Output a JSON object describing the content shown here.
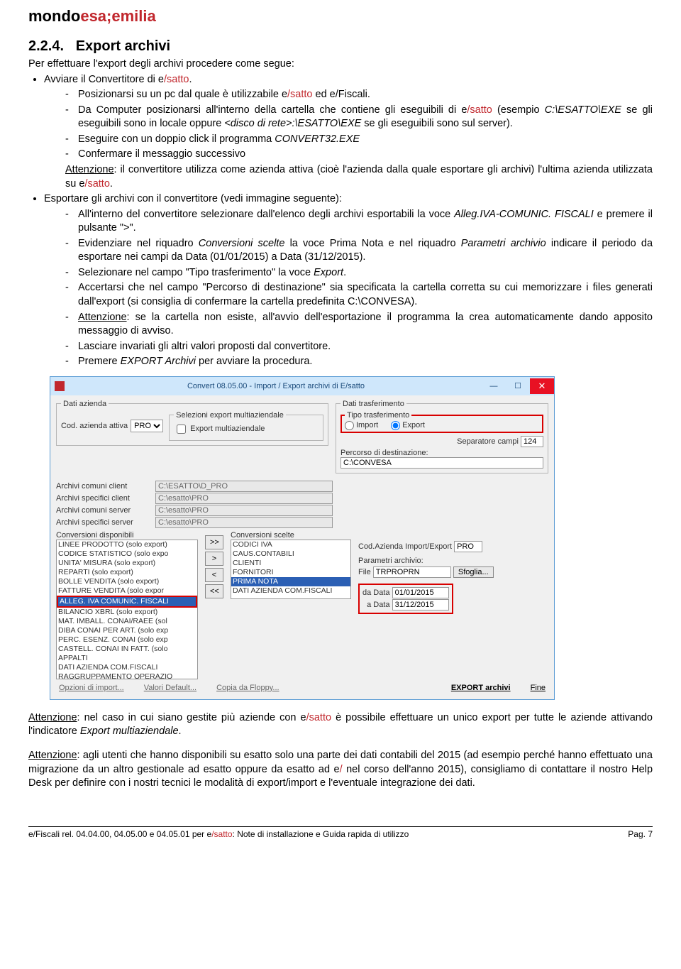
{
  "brand": {
    "part1": "mondo",
    "part2": "esa;emilia"
  },
  "section": {
    "number": "2.2.4.",
    "title": "Export archivi"
  },
  "intro": "Per effettuare l'export degli archivi procedere come segue:",
  "b1": {
    "pre": "Avviare il Convertitore di e",
    "satto": "/satto",
    "post": "."
  },
  "b1d1": {
    "pre": "Posizionarsi su un pc dal quale è utilizzabile e",
    "satto": "/satto",
    "post": " ed e/Fiscali."
  },
  "b1d2": {
    "pre": "Da Computer posizionarsi all'interno della cartella che contiene gli eseguibili di e",
    "satto1": "/satto",
    "mid1": " (esempio ",
    "ital1": "C:\\ESATTO\\EXE",
    "mid2": " se gli eseguibili sono in locale oppure ",
    "ital2": "<disco di rete>:\\ESATTO\\EXE",
    "post": " se gli eseguibili sono sul server)."
  },
  "b1d3": {
    "pre": "Eseguire con un doppio click il programma ",
    "ital": "CONVERT32.EXE"
  },
  "b1d4": "Confermare il messaggio successivo",
  "att1": {
    "u": "Attenzione",
    "pre": ": il convertitore utilizza come azienda attiva (cioè l'azienda dalla quale esportare gli archivi) l'ultima azienda utilizzata su e",
    "satto": "/satto",
    "post": "."
  },
  "b2": "Esportare gli archivi con il convertitore (vedi immagine seguente):",
  "b2d1": {
    "pre": "All'interno del convertitore selezionare dall'elenco degli archivi esportabili la voce ",
    "ital": "Alleg.IVA-COMUNIC. FISCALI",
    "post": " e premere il pulsante \">\"."
  },
  "b2d2": {
    "pre": "Evidenziare nel riquadro ",
    "i1": "Conversioni scelte",
    "mid1": " la voce Prima Nota e nel riquadro ",
    "i2": "Parametri archivio",
    "post": " indicare il periodo da esportare nei campi da Data (01/01/2015) a Data (31/12/2015)."
  },
  "b2d3": {
    "pre": "Selezionare nel campo \"Tipo trasferimento\" la voce ",
    "ital": "Export",
    "post": "."
  },
  "b2d4": "Accertarsi che nel campo \"Percorso di destinazione\" sia specificata la cartella corretta su cui memorizzare i files generati dall'export (si consiglia di confermare la cartella predefinita C:\\CONVESA).",
  "b2d5": {
    "u": "Attenzione",
    "post": ": se la cartella non esiste, all'avvio dell'esportazione il programma la crea automaticamente dando apposito messaggio di avviso."
  },
  "b2d6": "Lasciare invariati gli altri valori proposti dal convertitore.",
  "b2d7": {
    "pre": "Premere ",
    "ital": "EXPORT Archivi",
    "post": " per avviare la procedura."
  },
  "win": {
    "title": "Convert 08.05.00 - Import / Export archivi di E/satto",
    "fs_dati": "Dati azienda",
    "cod_az_label": "Cod. azienda attiva",
    "cod_az_val": "PRO",
    "fs_sel": "Selezioni export multiaziendale",
    "chk_multi": "Export multiaziendale",
    "fs_trasf": "Dati trasferimento",
    "fs_tipo": "Tipo trasferimento",
    "r_import": "Import",
    "r_export": "Export",
    "sep_label": "Separatore campi",
    "sep_val": "124",
    "perc_label": "Percorso di destinazione:",
    "perc_val": "C:\\CONVESA",
    "acc_label": "Archivi comuni client",
    "acc_val": "C:\\ESATTO\\D_PRO",
    "asc_label": "Archivi specifici client",
    "asc_val": "C:\\esatto\\PRO",
    "acs_label": "Archivi comuni server",
    "acs_val": "C:\\esatto\\PRO",
    "ass_label": "Archivi specifici server",
    "ass_val": "C:\\esatto\\PRO",
    "fs_disp": "Conversioni disponibili",
    "disp": [
      "LINEE PRODOTTO (solo export)",
      "CODICE STATISTICO (solo expo",
      "UNITA' MISURA (solo export)",
      "REPARTI (solo export)",
      "BOLLE VENDITA (solo export)",
      "FATTURE VENDITA (solo expor",
      "ALLEG. IVA COMUNIC. FISCALI",
      "BILANCIO XBRL (solo export)",
      "MAT. IMBALL. CONAI/RAEE (sol",
      "DIBA CONAI PER ART. (solo exp",
      "PERC. ESENZ. CONAI (solo exp",
      "CASTELL. CONAI IN FATT. (solo",
      "APPALTI",
      "DATI AZIENDA COM.FISCALI",
      "RAGGRUPPAMENTO OPERAZIO"
    ],
    "fs_scelte": "Conversioni scelte",
    "scelte": [
      "CODICI IVA",
      "CAUS.CONTABILI",
      "CLIENTI",
      "FORNITORI",
      "PRIMA NOTA",
      "DATI AZIENDA COM.FISCALI"
    ],
    "cod_ie_label": "Cod.Azienda Import/Export",
    "cod_ie_val": "PRO",
    "par_label": "Parametri archivio:",
    "file_label": "File",
    "file_val": "TRPROPRN",
    "sfoglia": "Sfoglia...",
    "da_label": "da Data",
    "da_val": "01/01/2015",
    "a_label": "a Data",
    "a_val": "31/12/2015",
    "btn_opz": "Opzioni di import...",
    "btn_val": "Valori Default...",
    "btn_floppy": "Copia da Floppy...",
    "btn_export": "EXPORT archivi",
    "btn_fine": "Fine"
  },
  "att2": {
    "u": "Attenzione",
    "pre": ": nel caso in cui siano gestite più aziende con e",
    "satto": "/satto",
    "mid": " è possibile effettuare un unico export per tutte le aziende attivando l'indicatore ",
    "ital": "Export multiaziendale",
    "post": "."
  },
  "att3": {
    "u": "Attenzione",
    "pre": ": agli utenti che hanno disponibili su esatto solo una parte dei dati contabili del 2015 (ad esempio perché hanno effettuato una migrazione da un altro gestionale ad esatto oppure da esatto ad e",
    "red": "/",
    "post": " nel corso dell'anno 2015), consigliamo di contattare il nostro Help Desk per definire con i nostri tecnici le modalità di export/import e l'eventuale integrazione dei dati."
  },
  "footer": {
    "left_pre": "e/Fiscali rel. 04.04.00, 04.05.00 e 04.05.01 per e",
    "satto": "/satto",
    "left_post": ": Note di installazione e Guida rapida di utilizzo",
    "right": "Pag. 7"
  }
}
